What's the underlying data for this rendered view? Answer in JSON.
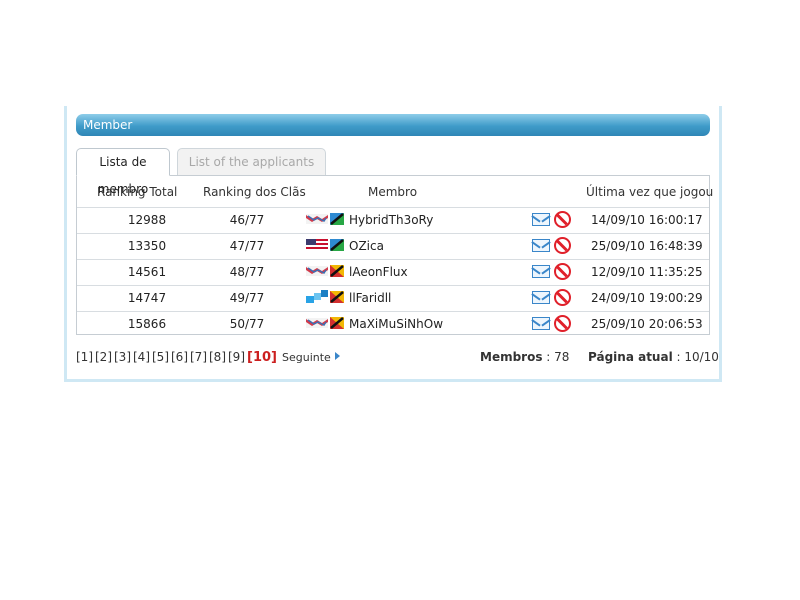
{
  "panel": {
    "title": "Member"
  },
  "tabs": {
    "active": "Lista de membro",
    "inactive": "List of the applicants"
  },
  "columns": {
    "rank_total": "Ranking Total",
    "rank_clan": "Ranking dos Clãs",
    "member": "Membro",
    "last_played": "Última vez que jogou"
  },
  "rows": [
    {
      "rank_total": "12988",
      "rank_clan": "46/77",
      "name": "HybridTh3oRy",
      "last_played": "14/09/10 16:00:17"
    },
    {
      "rank_total": "13350",
      "rank_clan": "47/77",
      "name": "OZica",
      "last_played": "25/09/10 16:48:39"
    },
    {
      "rank_total": "14561",
      "rank_clan": "48/77",
      "name": "lAeonFlux",
      "last_played": "12/09/10 11:35:25"
    },
    {
      "rank_total": "14747",
      "rank_clan": "49/77",
      "name": "llFaridll",
      "last_played": "24/09/10 19:00:29"
    },
    {
      "rank_total": "15866",
      "rank_clan": "50/77",
      "name": "MaXiMuSiNhOw",
      "last_played": "25/09/10 20:06:53"
    }
  ],
  "pagination": {
    "pages": [
      "[1]",
      "[2]",
      "[3]",
      "[4]",
      "[5]",
      "[6]",
      "[7]",
      "[8]",
      "[9]"
    ],
    "current": "[10]",
    "next": "Seguinte"
  },
  "stats": {
    "members_label": "Membros",
    "members_value": " : 78",
    "page_label": "Página atual",
    "page_value": " : 10/10"
  },
  "colors": {
    "header_bar": "#3f9bc9",
    "current_page": "#cc1f1f",
    "mail": "#3a86c9",
    "block": "#e0202a"
  }
}
